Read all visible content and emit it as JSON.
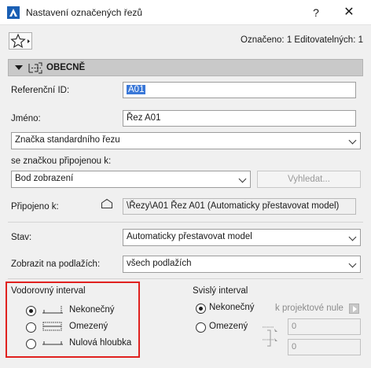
{
  "window": {
    "title": "Nastavení označených řezů",
    "help_label": "?",
    "close_label": "✕"
  },
  "toolbar": {
    "status": "Označeno: 1 Editovatelných: 1",
    "favorites_icon": "star-icon"
  },
  "section": {
    "title": "OBECNĚ"
  },
  "fields": {
    "ref_id_label": "Referenční ID:",
    "ref_id_value": "A01",
    "name_label": "Jméno:",
    "name_value": "Řez A01",
    "marker_type": "Značka standardního řezu",
    "linked_marker_label": "se značkou připojenou k:",
    "linked_marker_value": "Bod zobrazení",
    "browse_label": "Vyhledat...",
    "connected_label": "Připojeno k:",
    "connected_value": "\\Řezy\\A01 Řez A01 (Automaticky přestavovat model)",
    "status_label": "Stav:",
    "status_value": "Automaticky přestavovat model",
    "show_on_label": "Zobrazit na podlažích:",
    "show_on_value": "všech podlažích"
  },
  "horizontal_range": {
    "title": "Vodorovný interval",
    "options": [
      {
        "label": "Nekonečný",
        "selected": true
      },
      {
        "label": "Omezený",
        "selected": false
      },
      {
        "label": "Nulová hloubka",
        "selected": false
      }
    ]
  },
  "vertical_range": {
    "title": "Svislý interval",
    "options": [
      {
        "label": "Nekonečný",
        "selected": true
      },
      {
        "label": "Omezený",
        "selected": false
      }
    ],
    "reference_label": "k projektové nule",
    "top_value": "0",
    "bottom_value": "0"
  },
  "colors": {
    "highlight_box": "#e0211f",
    "selection": "#3a78d8",
    "section_header": "#c9c9c9"
  }
}
